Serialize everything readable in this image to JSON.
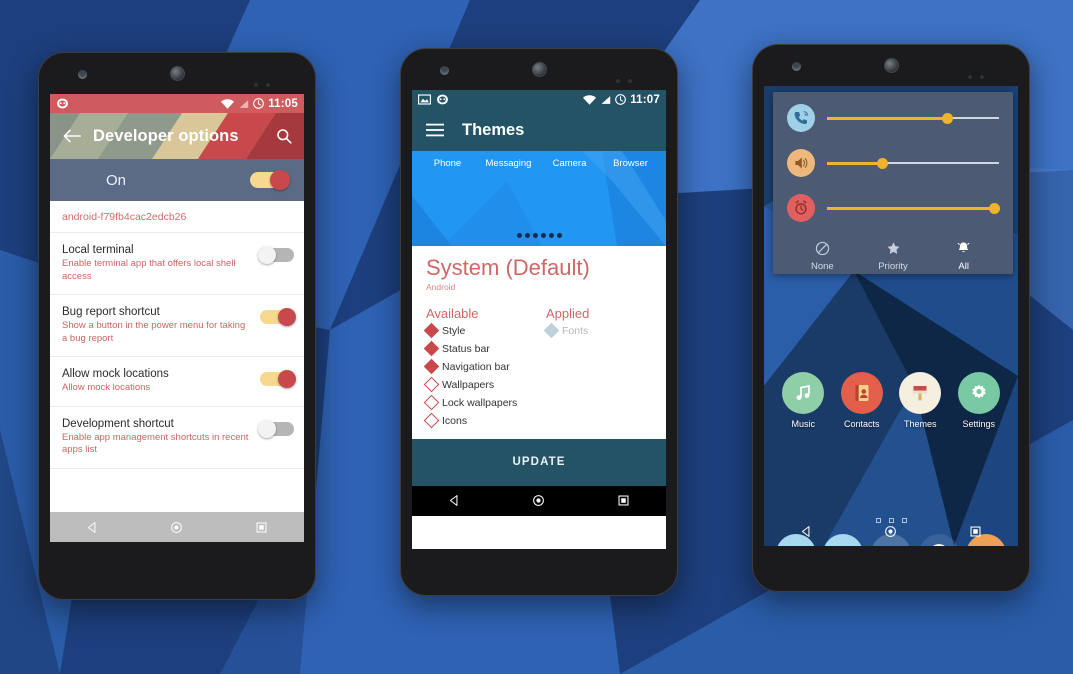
{
  "background": {
    "name": "geometric-blue-polygon-wallpaper",
    "base_color": "#2a5ca8",
    "palette": [
      "#1d3f7d",
      "#2a5ca8",
      "#3d72c4",
      "#2f62b4",
      "#4a83d6",
      "#16305f"
    ]
  },
  "phone1": {
    "name": "Developer options",
    "statusbar": {
      "time": "11:05",
      "left_icons": [
        "cyanogenmod-logo-icon"
      ],
      "right_icons": [
        "wifi-icon",
        "signal-icon",
        "alarm-icon"
      ],
      "background": "#cf5b5e"
    },
    "appbar": {
      "back_icon": "back-arrow-icon",
      "title": "Developer options",
      "search_icon": "search-icon",
      "stripe_colors": [
        "#8a9388",
        "#a8ad97",
        "#d9c79a",
        "#c9484c",
        "#a5393d"
      ]
    },
    "master_switch": {
      "label": "On",
      "state": "on",
      "background": "#5b6b85"
    },
    "device_id": "android-f79fb4cac2edcb26",
    "rows": [
      {
        "title": "Local terminal",
        "subtitle": "Enable terminal app that offers local shell access",
        "state": "off"
      },
      {
        "title": "Bug report shortcut",
        "subtitle": "Show a button in the power menu for taking a bug report",
        "state": "on"
      },
      {
        "title": "Allow mock locations",
        "subtitle": "Allow mock locations",
        "state": "on"
      },
      {
        "title": "Development shortcut",
        "subtitle": "Enable app management shortcuts in recent apps list",
        "state": "off"
      }
    ],
    "navbar": {
      "background": "#bdbdbd",
      "buttons": [
        "back-nav-icon",
        "home-nav-icon",
        "recents-nav-icon"
      ]
    }
  },
  "phone2": {
    "name": "Themes",
    "statusbar": {
      "time": "11:07",
      "left_icons": [
        "screenshot-icon",
        "cyanogenmod-logo-icon"
      ],
      "right_icons": [
        "wifi-icon",
        "signal-icon",
        "alarm-icon"
      ],
      "background": "#245366"
    },
    "appbar": {
      "menu_icon": "hamburger-menu-icon",
      "title": "Themes",
      "background": "#245366"
    },
    "preview": {
      "app_labels": [
        "Phone",
        "Messaging",
        "Camera",
        "Browser"
      ],
      "page_dots": 6,
      "background": "#2196f3"
    },
    "theme": {
      "name": "System (Default)",
      "author": "Android"
    },
    "columns": {
      "available_header": "Available",
      "applied_header": "Applied",
      "available": [
        {
          "label": "Style",
          "selected": true
        },
        {
          "label": "Status bar",
          "selected": true
        },
        {
          "label": "Navigation bar",
          "selected": true
        },
        {
          "label": "Wallpapers",
          "selected": false
        },
        {
          "label": "Lock wallpapers",
          "selected": false
        },
        {
          "label": "Icons",
          "selected": false
        }
      ],
      "applied": [
        {
          "label": "Fonts"
        }
      ]
    },
    "update_button": "UPDATE",
    "navbar": {
      "background": "#000000",
      "buttons": [
        "back-nav-icon",
        "home-nav-icon",
        "recents-nav-icon"
      ]
    }
  },
  "phone3": {
    "name": "Home screen with volume panel",
    "volume_panel": {
      "background": "#4c5a73",
      "sliders": [
        {
          "icon": "ring-volume-icon",
          "icon_bg": "#9fd0e8",
          "percent": 70
        },
        {
          "icon": "media-volume-icon",
          "icon_bg": "#eeb87c",
          "percent": 32
        },
        {
          "icon": "alarm-volume-icon",
          "icon_bg": "#e06060",
          "percent": 97
        }
      ],
      "modes": [
        {
          "icon": "none-mode-icon",
          "label": "None",
          "active": false
        },
        {
          "icon": "priority-mode-icon",
          "label": "Priority",
          "active": false
        },
        {
          "icon": "all-mode-icon",
          "label": "All",
          "active": true
        }
      ]
    },
    "apps": [
      {
        "label": "Music",
        "icon": "music-note-icon",
        "bg": "#8fcfa8"
      },
      {
        "label": "Contacts",
        "icon": "contacts-book-icon",
        "bg": "#e2604a"
      },
      {
        "label": "Themes",
        "icon": "paint-brush-icon",
        "bg": "#f5efe0"
      },
      {
        "label": "Settings",
        "icon": "gear-icon",
        "bg": "#79c9a4"
      }
    ],
    "page_dots": 3,
    "dock": [
      {
        "icon": "phone-icon",
        "bg": "#a8d8f0"
      },
      {
        "icon": "email-icon",
        "bg": "#a8d8f0"
      },
      {
        "icon": "app-drawer-icon",
        "bg": "rgba(255,255,255,0.20)"
      },
      {
        "icon": "browser-globe-icon",
        "bg": "rgba(255,255,255,0.10)"
      },
      {
        "icon": "camera-icon",
        "bg": "#f0a055"
      }
    ],
    "navbar": {
      "background": "transparent",
      "buttons": [
        "back-nav-icon",
        "home-nav-icon",
        "recents-nav-icon"
      ]
    }
  }
}
